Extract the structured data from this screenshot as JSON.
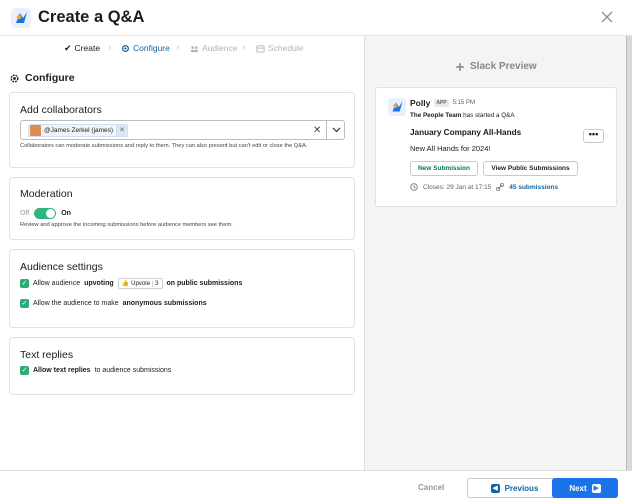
{
  "header": {
    "title": "Create a Q&A"
  },
  "steps": [
    {
      "label": "Create",
      "state": "done"
    },
    {
      "label": "Configure",
      "state": "active"
    },
    {
      "label": "Audience",
      "state": "todo"
    },
    {
      "label": "Schedule",
      "state": "todo"
    }
  ],
  "configure": {
    "title": "Configure",
    "collaborators": {
      "heading": "Add collaborators",
      "chip_label": "@James Zerkel (james)",
      "help": "Collaborators can moderate submissions and reply to them. They can also present but can't edit or close the Q&A."
    },
    "moderation": {
      "heading": "Moderation",
      "off_label": "Off",
      "on_label": "On",
      "help": "Review and approve the incoming submissions before audience members see them."
    },
    "audience": {
      "heading": "Audience settings",
      "upvote_prefix": "Allow audience",
      "upvote_bold": "upvoting",
      "upvote_pill_label": "Upvote",
      "upvote_pill_count": "3",
      "upvote_suffix": "on public submissions",
      "anon_prefix": "Allow the audience to make",
      "anon_bold": "anonymous submissions"
    },
    "text_replies": {
      "heading": "Text replies",
      "bold": "Allow text replies",
      "suffix": "to audience submissions"
    }
  },
  "preview": {
    "label": "Slack Preview",
    "app_name": "Polly",
    "app_badge": "APP",
    "time": "5:15 PM",
    "sub_team": "The People Team",
    "sub_rest": "has started a Q&A",
    "title": "January Company All-Hands",
    "more_button": "•••",
    "body": "New All Hands for 2024!",
    "btn_new": "New Submission",
    "btn_view": "View Public Submissions",
    "closes": "Closes: 29 Jan at 17:15",
    "submissions": "45 submissions"
  },
  "footer": {
    "cancel": "Cancel",
    "previous": "Previous",
    "next": "Next"
  },
  "colors": {
    "accent": "#1264a3",
    "primary_button": "#1a73e8",
    "toggle_on": "#2eb67d",
    "checkbox": "#2bac76"
  }
}
